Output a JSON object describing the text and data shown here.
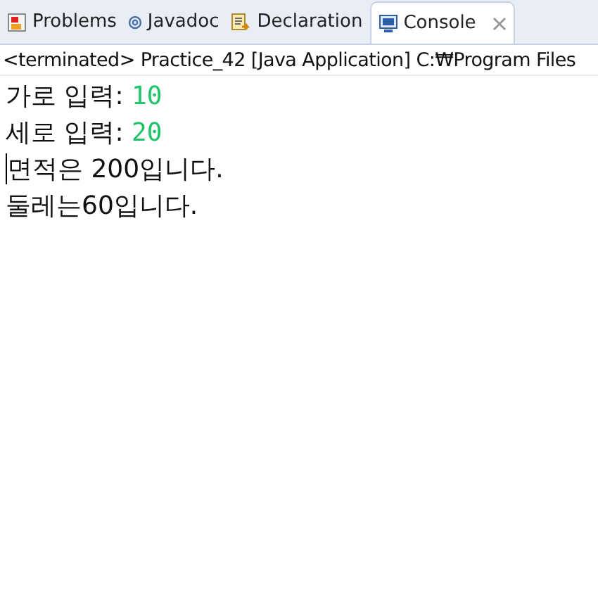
{
  "tabs": [
    {
      "label": "Problems",
      "kind": "problems",
      "selected": false
    },
    {
      "label": "Javadoc",
      "kind": "javadoc",
      "selected": false
    },
    {
      "label": "Declaration",
      "kind": "declaration",
      "selected": false
    },
    {
      "label": "Console",
      "kind": "console",
      "selected": true,
      "closable": true
    }
  ],
  "status": "<terminated> Practice_42 [Java Application] C:₩Program Files",
  "console": [
    {
      "segments": [
        {
          "text": "가로 입력: ",
          "kind": "output"
        },
        {
          "text": "10",
          "kind": "input"
        }
      ]
    },
    {
      "segments": [
        {
          "text": "세로 입력: ",
          "kind": "output"
        },
        {
          "text": "20",
          "kind": "input"
        }
      ]
    },
    {
      "cursor": true,
      "segments": [
        {
          "text": "면적은 200입니다.",
          "kind": "output"
        }
      ]
    },
    {
      "segments": [
        {
          "text": "둘레는60입니다.",
          "kind": "output"
        }
      ]
    }
  ]
}
